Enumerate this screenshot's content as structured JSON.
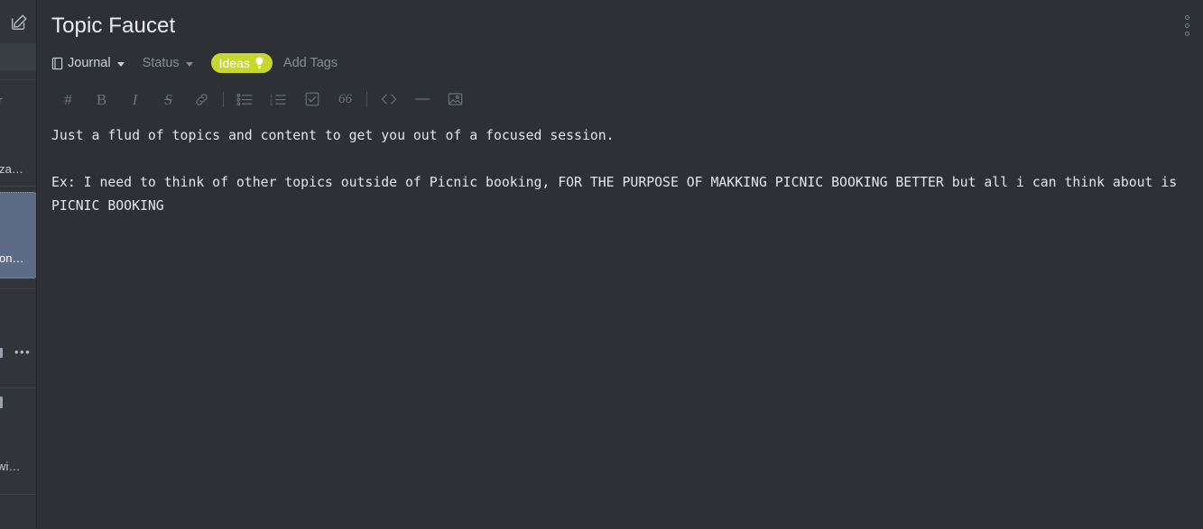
{
  "window": {
    "background_color": "#2d3136",
    "sidebar_color": "#31353a",
    "accent_tag_color": "#c5d82b",
    "selected_item_color": "#5d6c86"
  },
  "sidebar": {
    "compose_icon": "compose-edit-icon",
    "search_placeholder": "",
    "fragments": [
      {
        "text": "r",
        "dim": true
      },
      {
        "text": "za…",
        "dim": false
      },
      {
        "text": "on…",
        "dim": false,
        "selected": true
      },
      {
        "text": "y",
        "dim": true
      },
      {
        "text": "•••",
        "dim": false
      },
      {
        "text": "wi…",
        "dim": false
      }
    ]
  },
  "header": {
    "title": "Topic Faucet",
    "overflow_menu_icon": "kebab-menu-icon"
  },
  "meta": {
    "notebook": {
      "label": "Journal",
      "icon": "book-icon",
      "caret_icon": "chevron-down-icon"
    },
    "status": {
      "label": "Status",
      "caret_icon": "chevron-down-icon"
    },
    "tags": [
      {
        "label": "Ideas",
        "icon": "lightbulb-icon",
        "color": "#c5d82b"
      }
    ],
    "add_tags_label": "Add Tags"
  },
  "toolbar": {
    "items": [
      {
        "name": "heading-button",
        "icon": "hash-icon",
        "glyph": "#"
      },
      {
        "name": "bold-button",
        "icon": "bold-icon",
        "glyph": "B"
      },
      {
        "name": "italic-button",
        "icon": "italic-icon",
        "glyph": "I"
      },
      {
        "name": "strikethrough-button",
        "icon": "strikethrough-icon",
        "glyph": "S"
      },
      {
        "name": "link-button",
        "icon": "link-icon",
        "glyph": ""
      },
      {
        "name": "toolbar-divider-1",
        "icon": "divider",
        "glyph": ""
      },
      {
        "name": "bullet-list-button",
        "icon": "bullet-list-icon",
        "glyph": ""
      },
      {
        "name": "numbered-list-button",
        "icon": "numbered-list-icon",
        "glyph": ""
      },
      {
        "name": "checklist-button",
        "icon": "checkbox-icon",
        "glyph": ""
      },
      {
        "name": "blockquote-button",
        "icon": "quote-icon",
        "glyph": "66"
      },
      {
        "name": "toolbar-divider-2",
        "icon": "divider",
        "glyph": ""
      },
      {
        "name": "code-button",
        "icon": "code-brackets-icon",
        "glyph": ""
      },
      {
        "name": "horizontal-rule-button",
        "icon": "horizontal-rule-icon",
        "glyph": ""
      },
      {
        "name": "image-button",
        "icon": "image-icon",
        "glyph": ""
      }
    ]
  },
  "editor": {
    "paragraph_1": "Just a flud of topics and content to get you out of a focused session.",
    "paragraph_2": "Ex: I need to think of other topics outside of Picnic booking, FOR THE PURPOSE OF MAKKING PICNIC BOOKING BETTER but all i can think about is PICNIC BOOKING"
  }
}
